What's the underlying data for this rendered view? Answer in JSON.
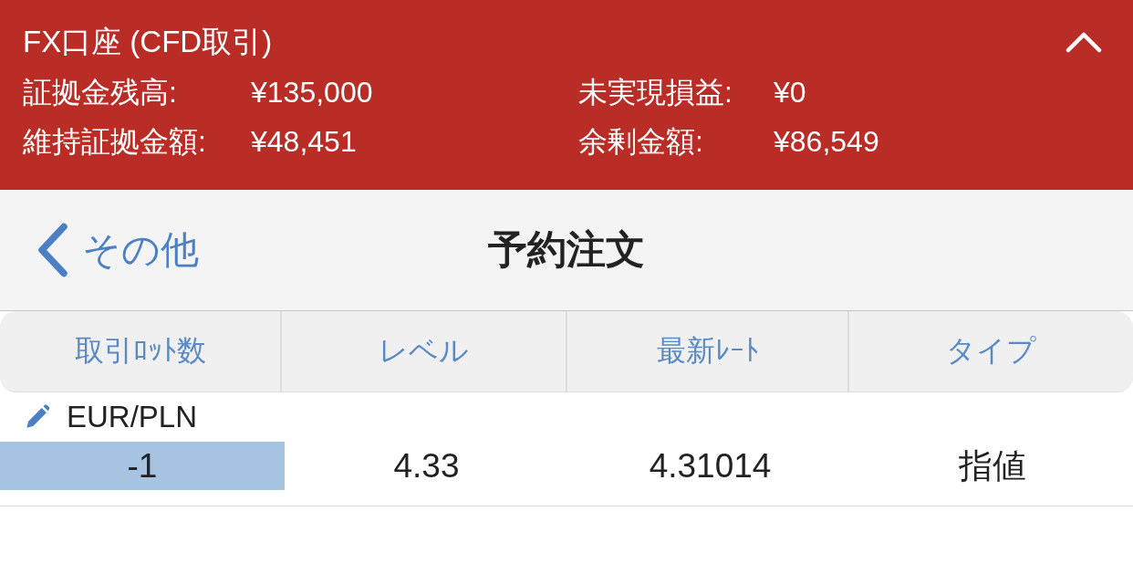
{
  "account": {
    "title": "FX口座 (CFD取引)",
    "expanded": true,
    "summary": [
      {
        "label": "証拠金残高:",
        "value": "¥135,000"
      },
      {
        "label": "未実現損益:",
        "value": "¥0"
      },
      {
        "label": "維持証拠金額:",
        "value": "¥48,451"
      },
      {
        "label": "余剰金額:",
        "value": "¥86,549"
      }
    ]
  },
  "nav": {
    "back_label": "その他",
    "title": "予約注文"
  },
  "table": {
    "columns": [
      "取引ﾛｯﾄ数",
      "レベル",
      "最新ﾚｰﾄ",
      "タイプ"
    ],
    "rows": [
      {
        "symbol": "EUR/PLN",
        "cells": [
          {
            "text": "-1",
            "highlighted": true
          },
          {
            "text": "4.33",
            "highlighted": false
          },
          {
            "text": "4.31014",
            "highlighted": false
          },
          {
            "text": "指値",
            "highlighted": false
          }
        ]
      }
    ]
  }
}
